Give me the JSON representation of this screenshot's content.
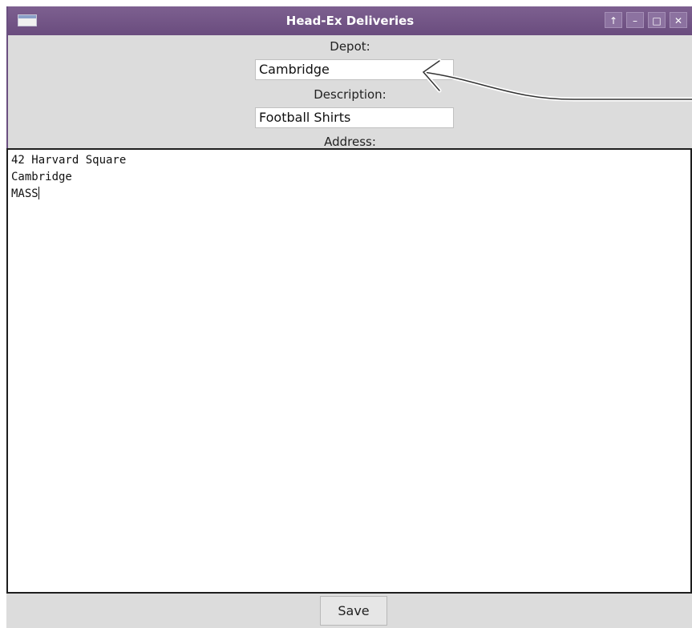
{
  "window": {
    "title": "Head-Ex Deliveries",
    "title_buttons": [
      "↑",
      "–",
      "□",
      "✕"
    ],
    "titlebar_color": "#6a4c7e"
  },
  "form": {
    "depot_label": "Depot:",
    "depot_value": "Cambridge",
    "description_label": "Description:",
    "description_value": "Football Shirts",
    "address_label": "Address:",
    "address_lines": [
      "42 Harvard Square",
      "Cambridge",
      "MASS"
    ]
  },
  "actions": {
    "save_label": "Save"
  }
}
